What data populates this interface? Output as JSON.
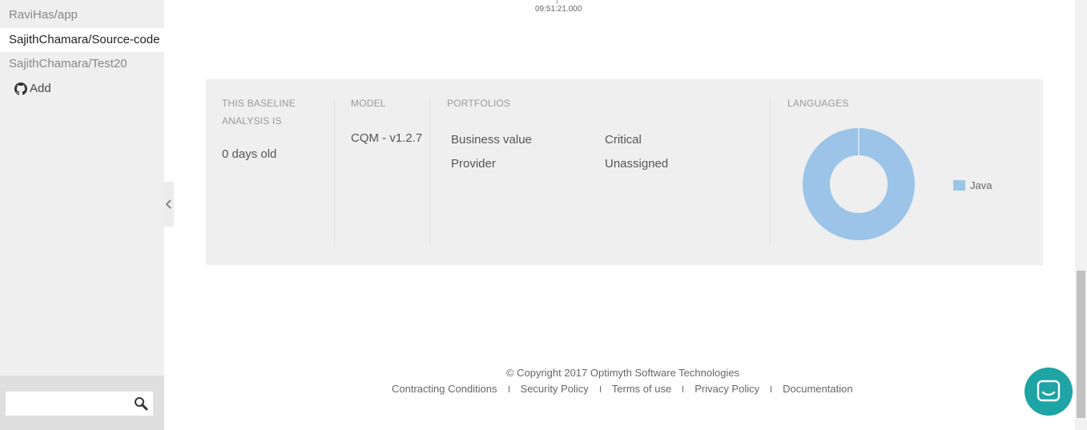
{
  "sidebar": {
    "repos": [
      {
        "label": "RaviHas/app",
        "active": false
      },
      {
        "label": "SajithChamara/Source-code",
        "active": true
      },
      {
        "label": "SajithChamara/Test20",
        "active": false
      }
    ],
    "add_label": "Add",
    "search": {
      "value": "",
      "placeholder": ""
    }
  },
  "timeline": {
    "timestamp": "09:51:21.000"
  },
  "baseline": {
    "age_label_line1": "THIS BASELINE",
    "age_label_line2": "ANALYSIS IS",
    "age_value": "0 days old",
    "model_label": "MODEL",
    "model_value": "CQM - v1.2.7",
    "portfolios_label": "PORTFOLIOS",
    "portfolios": [
      {
        "key": "Business value",
        "value": "Critical"
      },
      {
        "key": "Provider",
        "value": "Unassigned"
      }
    ],
    "languages_label": "LANGUAGES"
  },
  "chart_data": {
    "type": "pie",
    "categories": [
      "Java"
    ],
    "values": [
      100
    ],
    "colors": [
      "#9bc4e8"
    ],
    "legend_position": "right",
    "donut": true
  },
  "footer": {
    "copyright": "© Copyright 2017 Optimyth Software Technologies",
    "links": [
      "Contracting Conditions",
      "Security Policy",
      "Terms of use",
      "Privacy Policy",
      "Documentation"
    ]
  },
  "colors": {
    "accent": "#1ea4a4",
    "java": "#9bc4e8"
  }
}
